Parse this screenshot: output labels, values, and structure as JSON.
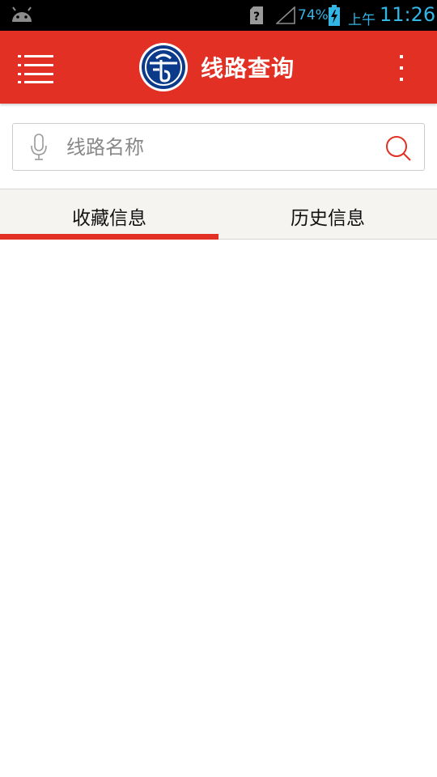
{
  "status_bar": {
    "battery_percent": "74%",
    "ampm": "上午",
    "time": "11:26",
    "icons": [
      "android-icon",
      "sim-unknown-icon",
      "signal-icon",
      "battery-charging-icon"
    ]
  },
  "app_bar": {
    "title": "线路查询",
    "color": "#e33024",
    "icons": [
      "menu-icon",
      "logo-icon",
      "more-vert-icon"
    ]
  },
  "search": {
    "placeholder": "线路名称",
    "value": "",
    "icons": [
      "microphone-icon",
      "search-icon"
    ]
  },
  "tabs": [
    {
      "label": "收藏信息",
      "selected": true
    },
    {
      "label": "历史信息",
      "selected": false
    }
  ]
}
